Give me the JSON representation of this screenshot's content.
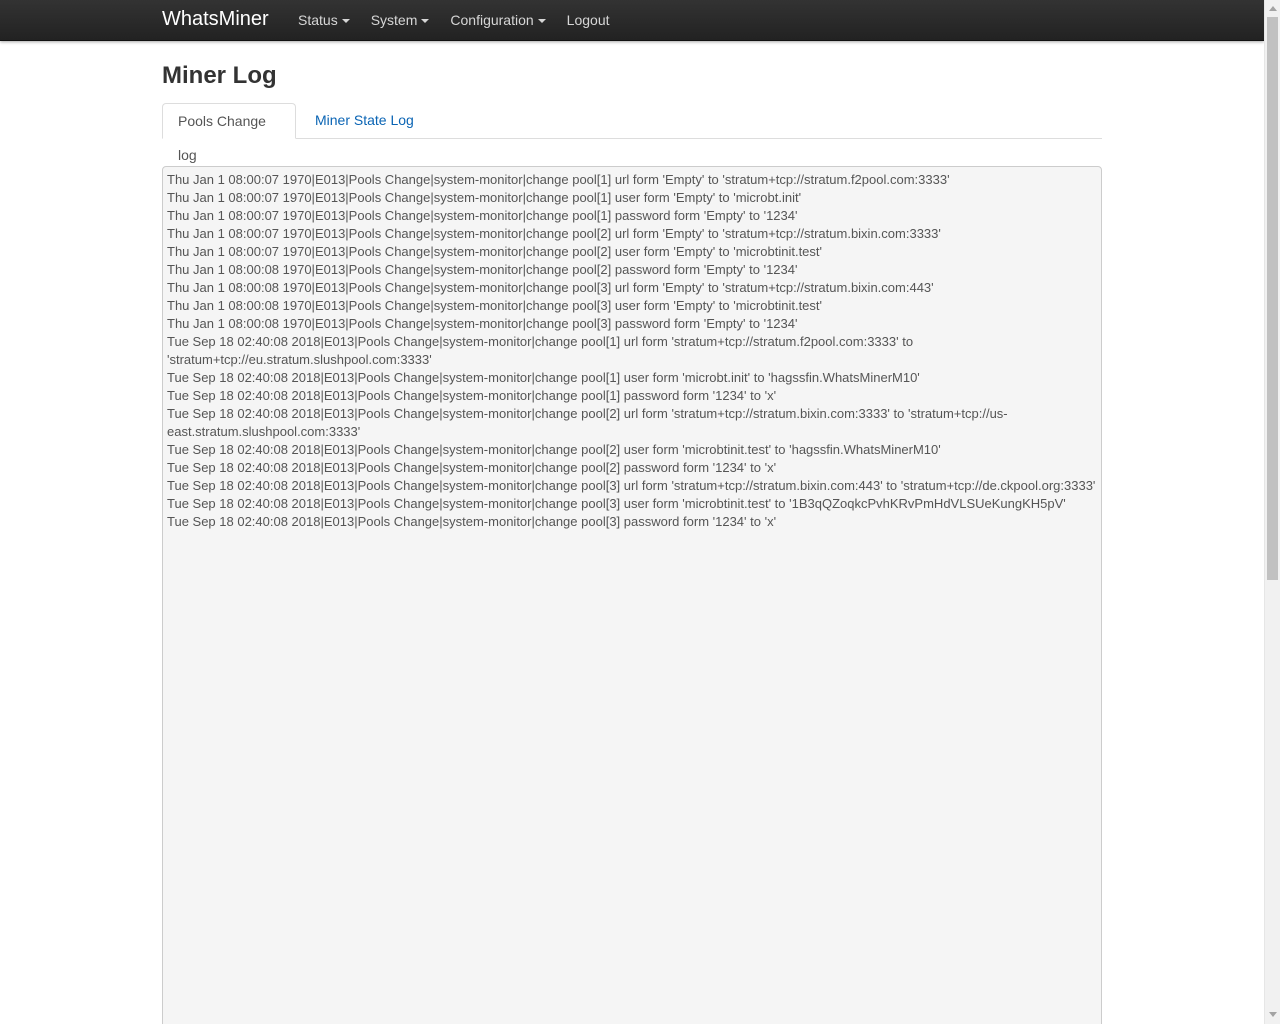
{
  "navbar": {
    "brand": "WhatsMiner",
    "items": [
      {
        "label": "Status",
        "dropdown": true
      },
      {
        "label": "System",
        "dropdown": true
      },
      {
        "label": "Configuration",
        "dropdown": true
      },
      {
        "label": "Logout",
        "dropdown": false
      }
    ]
  },
  "page": {
    "title": "Miner Log"
  },
  "tabs": [
    {
      "label": "Pools Change log",
      "active": true
    },
    {
      "label": "Miner State Log",
      "active": false
    }
  ],
  "log": {
    "lines": [
      "Thu Jan  1 08:00:07 1970|E013|Pools Change|system-monitor|change pool[1] url form 'Empty' to 'stratum+tcp://stratum.f2pool.com:3333'",
      "Thu Jan  1 08:00:07 1970|E013|Pools Change|system-monitor|change pool[1] user form 'Empty' to 'microbt.init'",
      "Thu Jan  1 08:00:07 1970|E013|Pools Change|system-monitor|change pool[1] password form 'Empty' to '1234'",
      "Thu Jan  1 08:00:07 1970|E013|Pools Change|system-monitor|change pool[2] url form 'Empty' to 'stratum+tcp://stratum.bixin.com:3333'",
      "Thu Jan  1 08:00:07 1970|E013|Pools Change|system-monitor|change pool[2] user form 'Empty' to 'microbtinit.test'",
      "Thu Jan  1 08:00:08 1970|E013|Pools Change|system-monitor|change pool[2] password form 'Empty' to '1234'",
      "Thu Jan  1 08:00:08 1970|E013|Pools Change|system-monitor|change pool[3] url form 'Empty' to 'stratum+tcp://stratum.bixin.com:443'",
      "Thu Jan  1 08:00:08 1970|E013|Pools Change|system-monitor|change pool[3] user form 'Empty' to 'microbtinit.test'",
      "Thu Jan  1 08:00:08 1970|E013|Pools Change|system-monitor|change pool[3] password form 'Empty' to '1234'",
      "Tue Sep 18 02:40:08 2018|E013|Pools Change|system-monitor|change pool[1] url form 'stratum+tcp://stratum.f2pool.com:3333' to 'stratum+tcp://eu.stratum.slushpool.com:3333'",
      "Tue Sep 18 02:40:08 2018|E013|Pools Change|system-monitor|change pool[1] user form 'microbt.init' to 'hagssfin.WhatsMinerM10'",
      "Tue Sep 18 02:40:08 2018|E013|Pools Change|system-monitor|change pool[1] password form '1234' to 'x'",
      "Tue Sep 18 02:40:08 2018|E013|Pools Change|system-monitor|change pool[2] url form 'stratum+tcp://stratum.bixin.com:3333' to 'stratum+tcp://us-east.stratum.slushpool.com:3333'",
      "Tue Sep 18 02:40:08 2018|E013|Pools Change|system-monitor|change pool[2] user form 'microbtinit.test' to 'hagssfin.WhatsMinerM10'",
      "Tue Sep 18 02:40:08 2018|E013|Pools Change|system-monitor|change pool[2] password form '1234' to 'x'",
      "Tue Sep 18 02:40:08 2018|E013|Pools Change|system-monitor|change pool[3] url form 'stratum+tcp://stratum.bixin.com:443' to 'stratum+tcp://de.ckpool.org:3333'",
      "Tue Sep 18 02:40:08 2018|E013|Pools Change|system-monitor|change pool[3] user form 'microbtinit.test' to '1B3qQZoqkcPvhKRvPmHdVLSUeKungKH5pV'",
      "Tue Sep 18 02:40:08 2018|E013|Pools Change|system-monitor|change pool[3] password form '1234' to 'x'"
    ]
  },
  "colors": {
    "navbar_bg": "#222222",
    "link": "#0a64b4",
    "log_bg": "#f5f5f5"
  }
}
